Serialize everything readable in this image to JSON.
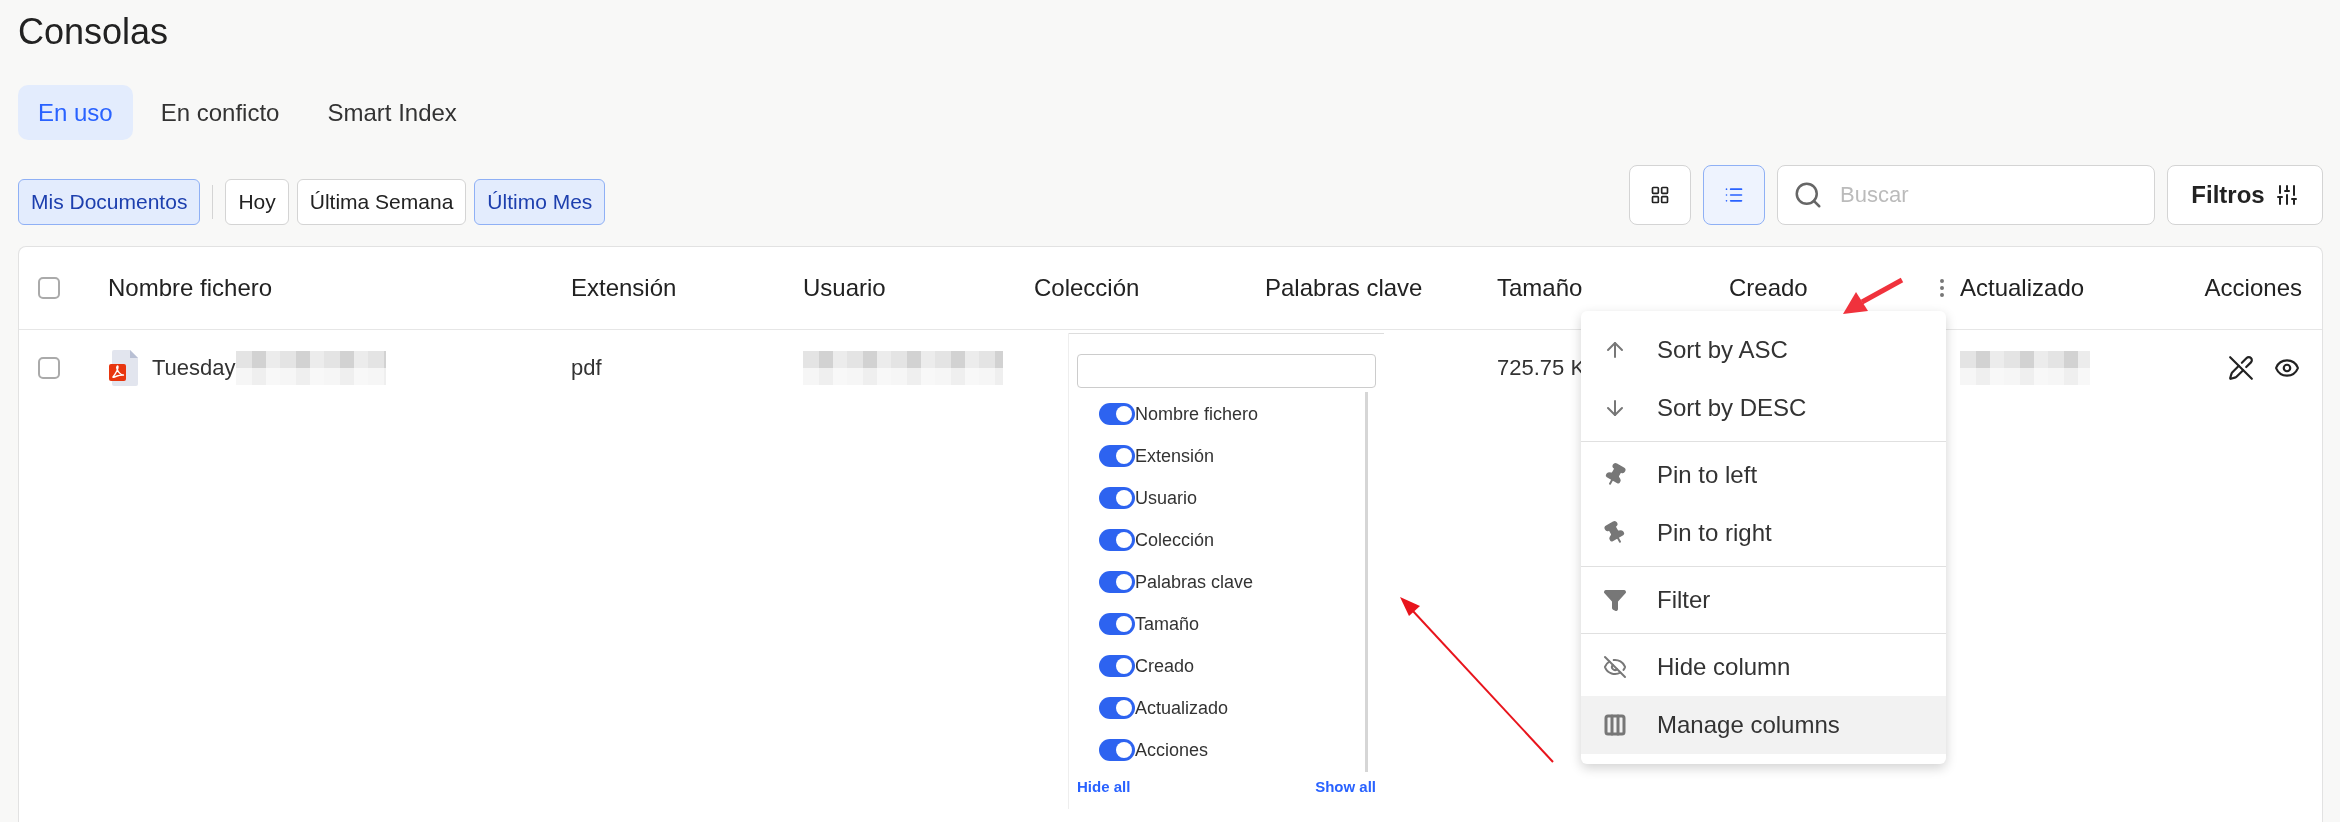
{
  "page": {
    "title": "Consolas"
  },
  "tabs": [
    {
      "label": "En uso",
      "selected": true
    },
    {
      "label": "En conficto",
      "selected": false
    },
    {
      "label": "Smart Index",
      "selected": false
    }
  ],
  "chips": [
    {
      "kind": "scope",
      "label": "Mis Documentos",
      "selected": true
    },
    {
      "kind": "period",
      "label": "Hoy",
      "selected": false
    },
    {
      "kind": "period",
      "label": "Última Semana",
      "selected": false
    },
    {
      "kind": "period",
      "label": "Último Mes",
      "selected": true
    }
  ],
  "view_toggle": [
    {
      "kind": "grid",
      "selected": false
    },
    {
      "kind": "list",
      "selected": true
    }
  ],
  "search": {
    "placeholder": "Buscar"
  },
  "filters_button": {
    "label": "Filtros"
  },
  "table": {
    "select_all_checked": false,
    "columns": [
      {
        "label": "Nombre fichero",
        "menu_icon": false
      },
      {
        "label": "Extensión",
        "menu_icon": false
      },
      {
        "label": "Usuario",
        "menu_icon": false
      },
      {
        "label": "Colección",
        "menu_icon": false
      },
      {
        "label": "Palabras clave",
        "menu_icon": false
      },
      {
        "label": "Tamaño",
        "menu_icon": false
      },
      {
        "label": "Creado",
        "menu_icon": true
      },
      {
        "label": "Actualizado",
        "menu_icon": false
      },
      {
        "label": "Acciones",
        "menu_icon": false
      }
    ],
    "rows": [
      {
        "checked": false,
        "file_name": "Tuesday",
        "extension": "pdf",
        "size": "725.75 K"
      }
    ]
  },
  "column_menu": {
    "groups": [
      [
        {
          "kind": "sort-asc",
          "label": "Sort by ASC",
          "highlighted": false
        },
        {
          "kind": "sort-desc",
          "label": "Sort by DESC",
          "highlighted": false
        }
      ],
      [
        {
          "kind": "pin-left",
          "label": "Pin to left",
          "highlighted": false
        },
        {
          "kind": "pin-right",
          "label": "Pin to right",
          "highlighted": false
        }
      ],
      [
        {
          "kind": "filter",
          "label": "Filter",
          "highlighted": false
        }
      ],
      [
        {
          "kind": "hide",
          "label": "Hide column",
          "highlighted": false
        },
        {
          "kind": "manage",
          "label": "Manage columns",
          "highlighted": true
        }
      ]
    ]
  },
  "column_manager": {
    "items": [
      {
        "label": "Nombre fichero",
        "on": true
      },
      {
        "label": "Extensión",
        "on": true
      },
      {
        "label": "Usuario",
        "on": true
      },
      {
        "label": "Colección",
        "on": true
      },
      {
        "label": "Palabras clave",
        "on": true
      },
      {
        "label": "Tamaño",
        "on": true
      },
      {
        "label": "Creado",
        "on": true
      },
      {
        "label": "Actualizado",
        "on": true
      },
      {
        "label": "Acciones",
        "on": true
      }
    ],
    "hide_all": "Hide all",
    "show_all": "Show all"
  }
}
